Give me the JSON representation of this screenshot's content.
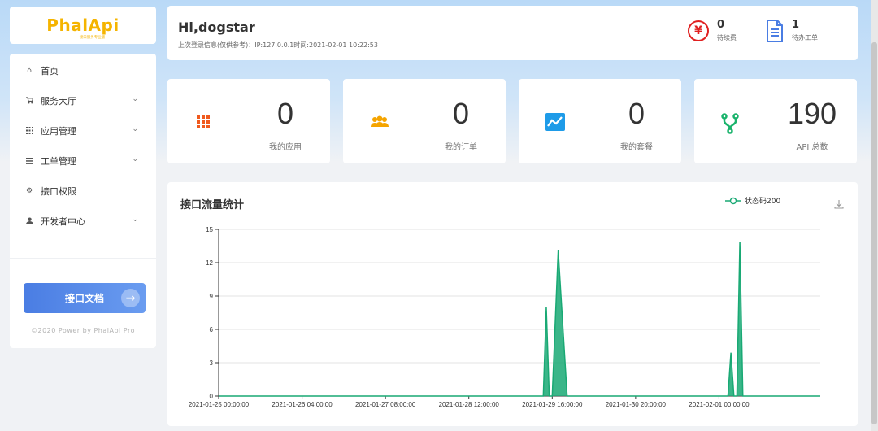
{
  "logo": {
    "text": "PhalApi",
    "subtitle": "接口服务专业版"
  },
  "sidebar": {
    "items": [
      {
        "label": "首页",
        "icon": "home-icon",
        "has_children": false
      },
      {
        "label": "服务大厅",
        "icon": "cart-icon",
        "has_children": true
      },
      {
        "label": "应用管理",
        "icon": "grid-icon",
        "has_children": true
      },
      {
        "label": "工单管理",
        "icon": "list-icon",
        "has_children": true
      },
      {
        "label": "接口权限",
        "icon": "gear-icon",
        "has_children": false
      },
      {
        "label": "开发者中心",
        "icon": "user-icon",
        "has_children": true
      }
    ],
    "doc_button": "接口文档",
    "copyright": "©2020 Power by PhalApi Pro"
  },
  "header": {
    "greeting": "Hi,dogstar",
    "last_login": "上次登录信息(仅供参考)：IP:127.0.0.1时间:2021-02-01 10:22:53",
    "pending_renewal": {
      "value": "0",
      "label": "待续费",
      "icon": "yen-icon",
      "color": "#e02020"
    },
    "pending_tickets": {
      "value": "1",
      "label": "待办工单",
      "icon": "document-icon",
      "color": "#4a7de3"
    }
  },
  "cards": [
    {
      "value": "0",
      "label": "我的应用",
      "icon": "apps-grid-icon",
      "color": "#f05a1e"
    },
    {
      "value": "0",
      "label": "我的订单",
      "icon": "users-icon",
      "color": "#f5a400"
    },
    {
      "value": "0",
      "label": "我的套餐",
      "icon": "trend-chart-icon",
      "color": "#1e9be8"
    },
    {
      "value": "190",
      "label": "API 总数",
      "icon": "branch-icon",
      "color": "#19b36b"
    }
  ],
  "chart": {
    "title": "接口流量统计",
    "legend": "状态码200"
  },
  "chart_data": {
    "type": "area",
    "title": "接口流量统计",
    "series": [
      {
        "name": "状态码200",
        "color": "#19a974",
        "points": [
          [
            "2021-01-25 00:00",
            0
          ],
          [
            "2021-01-29 13:00",
            0
          ],
          [
            "2021-01-29 14:00",
            8
          ],
          [
            "2021-01-29 15:00",
            0
          ],
          [
            "2021-01-29 16:00",
            0
          ],
          [
            "2021-01-29 18:00",
            13.1
          ],
          [
            "2021-01-29 21:00",
            0
          ],
          [
            "2021-02-01 03:00",
            0
          ],
          [
            "2021-02-01 04:00",
            3.9
          ],
          [
            "2021-02-01 05:00",
            0
          ],
          [
            "2021-02-01 06:00",
            0
          ],
          [
            "2021-02-01 07:00",
            13.9
          ],
          [
            "2021-02-01 08:00",
            0
          ],
          [
            "2021-02-02 10:00",
            0
          ]
        ]
      }
    ],
    "x_ticks": [
      "2021-01-25 00:00:00",
      "2021-01-26 04:00:00",
      "2021-01-27 08:00:00",
      "2021-01-28 12:00:00",
      "2021-01-29 16:00:00",
      "2021-01-30 20:00:00",
      "2021-02-01 00:00:00"
    ],
    "y_ticks": [
      "0",
      "3",
      "6",
      "9",
      "12",
      "15"
    ],
    "ylim": [
      0,
      15
    ],
    "xlim": [
      "2021-01-25 00:00",
      "2021-02-02 10:00"
    ],
    "grid": true
  }
}
